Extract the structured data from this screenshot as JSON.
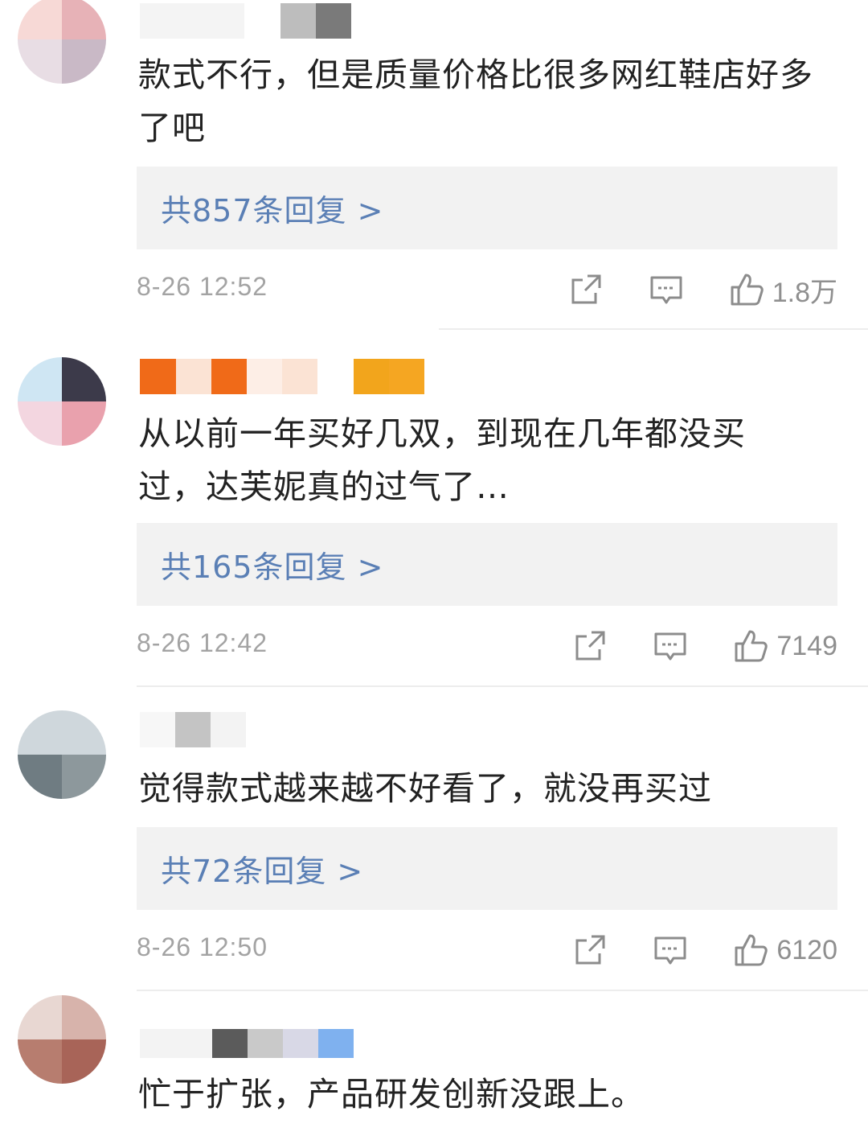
{
  "comments": [
    {
      "text": "款式不行，但是质量价格比很多网红鞋店好多了吧",
      "replies_label": "共857条回复 >",
      "time": "8-26 12:52",
      "likes": "1.8万",
      "avatar_colors": [
        "#f7d9d6",
        "#e7b2b7",
        "#c9b9c6",
        "#8f8090"
      ],
      "name_colors": [
        "#dcdcdc",
        "#bdbdbd",
        "#8a8a8a",
        "#6a6a6a"
      ]
    },
    {
      "text": "从以前一年买好几双，到现在几年都没买过，达芙妮真的过气了…",
      "replies_label": "共165条回复 >",
      "time": "8-26 12:42",
      "likes": "7149",
      "avatar_colors": [
        "#cfe6f3",
        "#3c3a4a",
        "#f3d6e0",
        "#e9a1ad"
      ],
      "name_colors": [
        "#f06a18",
        "#fbe3d4",
        "#f06a18",
        "#fce7db",
        "#fbe3d4",
        "#f2a51c",
        "#f5a622"
      ]
    },
    {
      "text": "觉得款式越来越不好看了，就没再买过",
      "replies_label": "共72条回复 >",
      "time": "8-26 12:50",
      "likes": "6120",
      "avatar_colors": [
        "#cfd7dc",
        "#dde3e7",
        "#6f7c82",
        "#8d989c"
      ],
      "name_colors": [
        "#e6e6e6",
        "#b5b5b5"
      ]
    },
    {
      "text": "忙于扩张，产品研发创新没跟上。",
      "avatar_colors": [
        "#e8d7d2",
        "#b77d6f",
        "#f4ece9",
        "#a86458"
      ],
      "name_colors": [
        "#eaeaea",
        "#5b5b5b",
        "#c9c9c9",
        "#7fb1ef"
      ]
    }
  ]
}
